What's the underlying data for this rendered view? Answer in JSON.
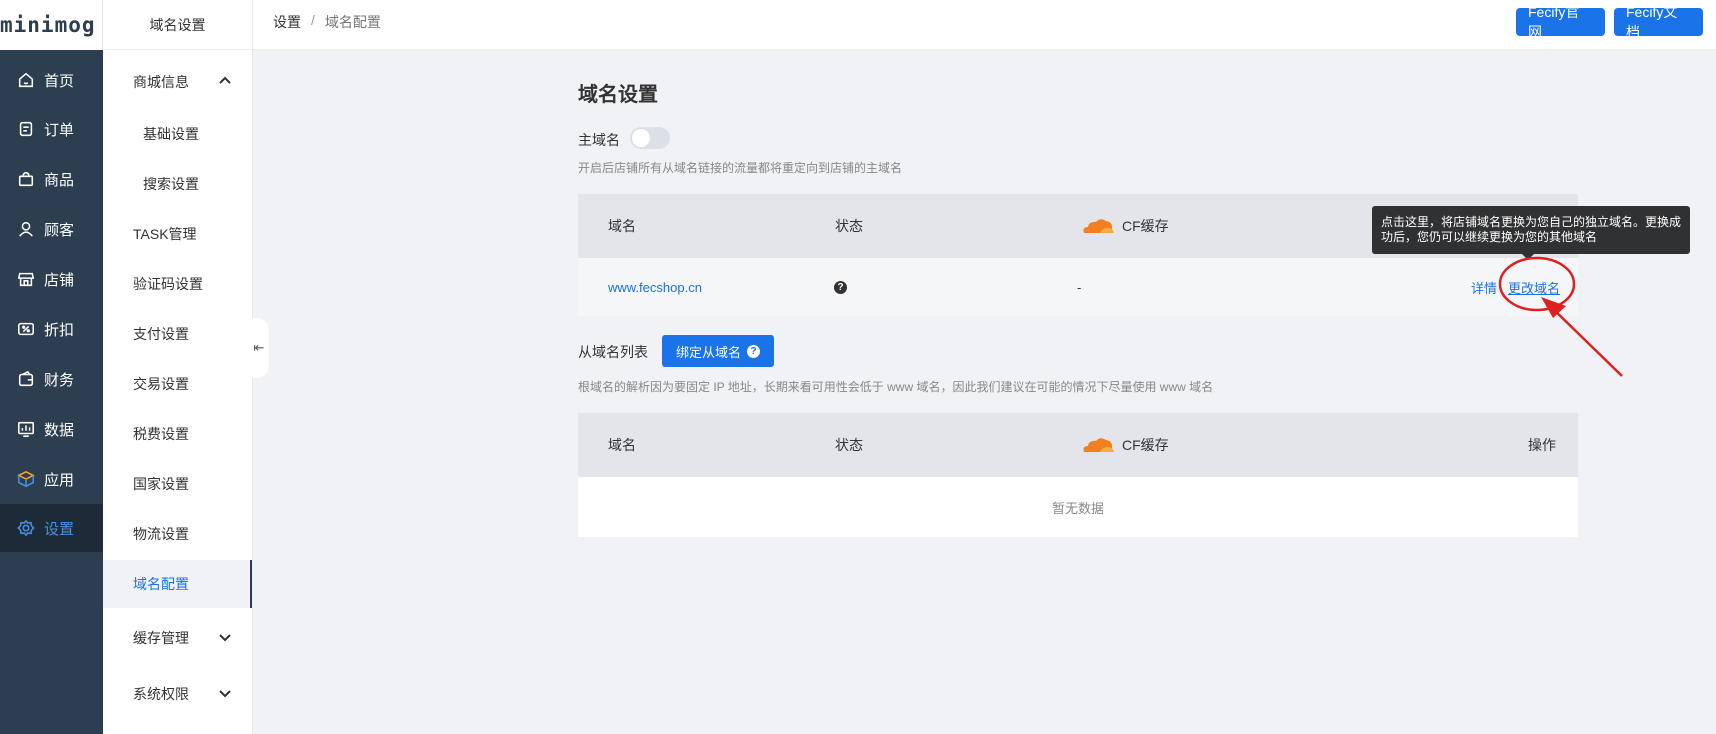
{
  "app": {
    "logo": "minimog"
  },
  "nav": [
    {
      "label": "首页",
      "icon": "home-icon"
    },
    {
      "label": "订单",
      "icon": "order-icon"
    },
    {
      "label": "商品",
      "icon": "bag-icon"
    },
    {
      "label": "顾客",
      "icon": "user-icon"
    },
    {
      "label": "店铺",
      "icon": "store-icon"
    },
    {
      "label": "折扣",
      "icon": "discount-icon"
    },
    {
      "label": "财务",
      "icon": "wallet-icon"
    },
    {
      "label": "数据",
      "icon": "chart-icon"
    },
    {
      "label": "应用",
      "icon": "cube-icon"
    },
    {
      "label": "设置",
      "icon": "gear-icon",
      "active": true
    }
  ],
  "subnav": {
    "title": "域名设置",
    "items": [
      {
        "label": "商城信息",
        "expanded": true
      },
      {
        "label": "基础设置"
      },
      {
        "label": "搜索设置"
      },
      {
        "label": "TASK管理"
      },
      {
        "label": "验证码设置"
      },
      {
        "label": "支付设置"
      },
      {
        "label": "交易设置"
      },
      {
        "label": "税费设置"
      },
      {
        "label": "国家设置"
      },
      {
        "label": "物流设置"
      },
      {
        "label": "域名配置",
        "active": true
      },
      {
        "label": "缓存管理",
        "expanded": false
      },
      {
        "label": "系统权限",
        "expanded": false
      }
    ]
  },
  "header": {
    "breadcrumb": [
      "设置",
      "/",
      "域名配置"
    ],
    "buttons": [
      "Fecify官网",
      "Fecify文档"
    ]
  },
  "main": {
    "title": "域名设置",
    "primary": {
      "label": "主域名",
      "toggle_on": false,
      "hint": "开启后店铺所有从域名链接的流量都将重定向到店铺的主域名",
      "columns": [
        "域名",
        "状态",
        "CF缓存"
      ],
      "row": {
        "domain": "www.fecshop.cn",
        "status_icon": "?",
        "cf": "-",
        "detail": "详情",
        "change": "更改域名"
      }
    },
    "secondary": {
      "label": "从域名列表",
      "bind_button": "绑定从域名",
      "hint": "根域名的解析因为要固定 IP 地址，长期来看可用性会低于 www 域名，因此我们建议在可能的情况下尽量使用 www 域名",
      "columns": [
        "域名",
        "状态",
        "CF缓存",
        "操作"
      ],
      "empty": "暂无数据"
    },
    "tooltip": "点击这里，将店铺域名更换为您自己的独立域名。更换成功后，您仍可以继续更换为您的其他域名"
  },
  "colors": {
    "primary": "#1a73e8",
    "sidebar": "#2c3e50",
    "annotation": "#e02020",
    "cloudflare": "#f38020"
  }
}
